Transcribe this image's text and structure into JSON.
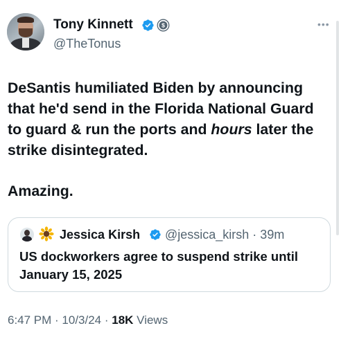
{
  "author": {
    "name": "Tony Kinnett",
    "handle": "@TheTonus"
  },
  "tweet": {
    "lines": [
      "DeSantis humiliated Biden by announcing",
      "that he'd send in the Florida National Guard",
      "to guard & run the ports and ",
      "strike disintegrated."
    ],
    "emphasis": "hours",
    "line3_tail": " later the",
    "closing": "Amazing."
  },
  "quoted": {
    "name": "Jessica Kirsh",
    "handle_time": "@jessica_kirsh · 39m",
    "lines": [
      "US dockworkers agree to suspend strike until",
      "January 15, 2025"
    ]
  },
  "meta": {
    "time_date": "6:47 PM · 10/3/24 · ",
    "views_count": "18K",
    "views_label": " Views"
  },
  "colors": {
    "verified_blue": "#1d9bf0",
    "secondary_text": "#536471",
    "border": "#cfd9de"
  },
  "icons": [
    "verified-badge-icon",
    "dollar-coin-badge-icon",
    "more-options-icon",
    "sunflower-emoji-icon"
  ]
}
